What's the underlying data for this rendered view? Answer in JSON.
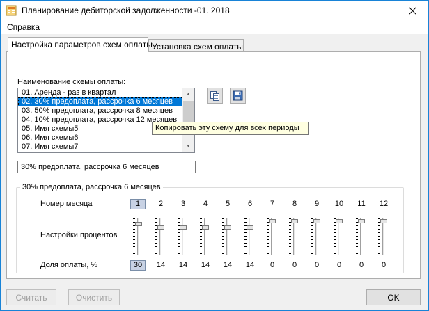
{
  "window": {
    "title": "Планирование дебиторской задолженности -01. 2018"
  },
  "menu": {
    "help": "Справка"
  },
  "tabs": [
    {
      "label": "Настройка параметров схем оплаты",
      "active": true
    },
    {
      "label": "Установка схем оплаты",
      "active": false
    }
  ],
  "schemes": {
    "label": "Наименование схемы оплаты:",
    "items": [
      "01. Аренда - раз в квартал",
      "02. 30% предоплата, рассрочка 6 месяцев",
      "03. 50% предоплата, рассрочка 8 месяцев",
      "04. 10% предоплата, рассрочка 12 месяцев",
      "05. Имя схемы5",
      "06. Имя схемы6",
      "07. Имя схемы7"
    ],
    "selected_index": 1,
    "name_value": "30% предоплата, рассрочка 6 месяцев"
  },
  "tooltip": "Копировать эту схему для всех периоды",
  "group": {
    "title": "30% предоплата, рассрочка 6 месяцев",
    "month_label": "Номер месяца",
    "percent_settings_label": "Настройки процентов",
    "share_label": "Доля оплаты, %",
    "months": [
      "1",
      "2",
      "3",
      "4",
      "5",
      "6",
      "7",
      "8",
      "9",
      "10",
      "11",
      "12"
    ],
    "shares": [
      "30",
      "14",
      "14",
      "14",
      "14",
      "14",
      "0",
      "0",
      "0",
      "0",
      "0",
      "0"
    ],
    "selected_month_index": 0
  },
  "buttons": {
    "calculate": "Считать",
    "clear": "Очистить",
    "ok": "OK"
  },
  "colors": {
    "selection": "#0078d7",
    "window_border": "#1883d7",
    "tooltip_bg": "#ffffe1"
  }
}
